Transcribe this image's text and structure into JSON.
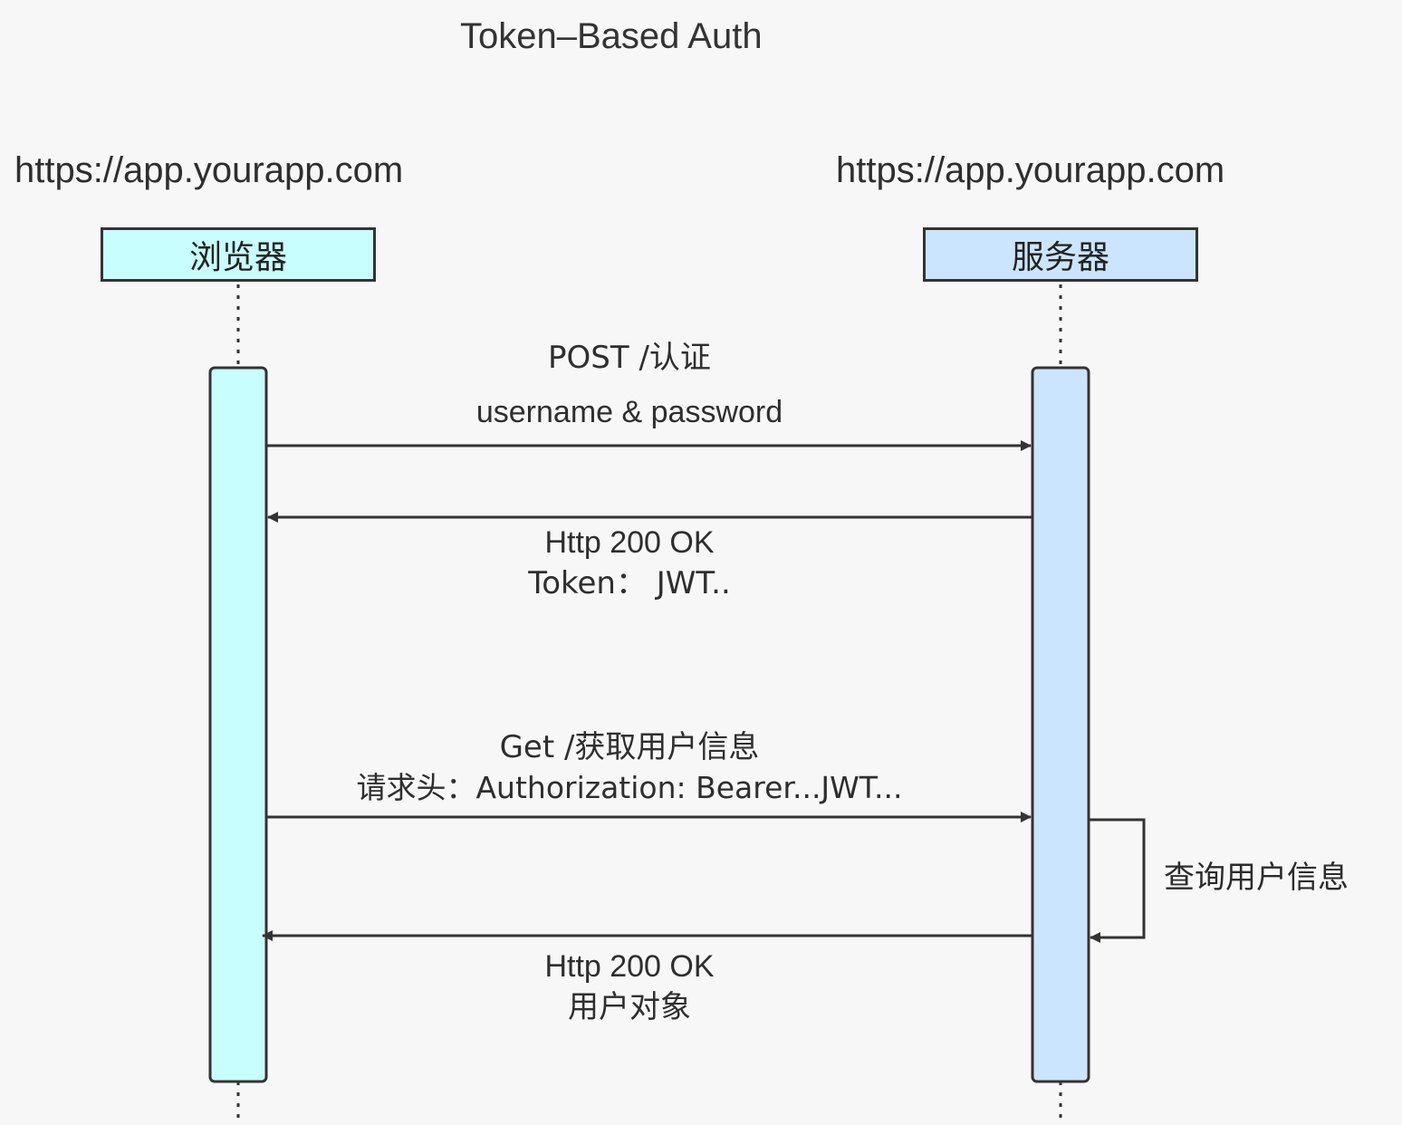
{
  "title": "Token–Based Auth",
  "participants": {
    "browser": {
      "url": "https://app.yourapp.com",
      "label": "浏览器",
      "color": "#c9fefe"
    },
    "server": {
      "url": "https://app.yourapp.com",
      "label": "服务器",
      "color": "#cce5fe"
    }
  },
  "messages": {
    "m1": {
      "line1": "POST /认证",
      "line2": "username & password",
      "direction": "browser-to-server"
    },
    "m2": {
      "line1": "Http 200 OK",
      "line2": "Token：  JWT..",
      "direction": "server-to-browser"
    },
    "m3": {
      "line1": "Get /获取用户信息",
      "line2": "请求头：Authorization: Bearer...JWT...",
      "direction": "browser-to-server"
    },
    "self": {
      "label": "查询用户信息",
      "direction": "server-to-server"
    },
    "m4": {
      "line1": "Http 200 OK",
      "line2": "用户对象",
      "direction": "server-to-browser"
    }
  }
}
